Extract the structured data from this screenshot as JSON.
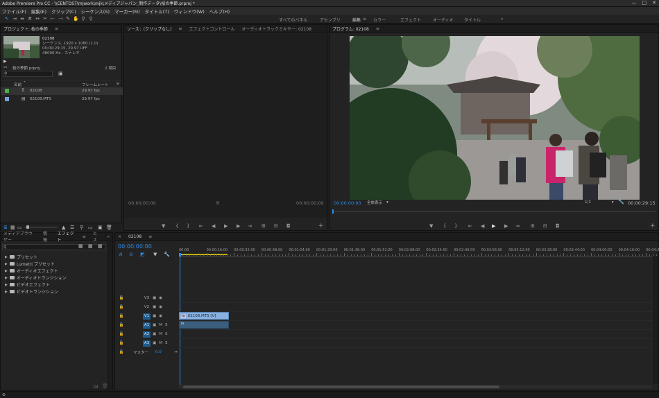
{
  "window": {
    "title": "Adobe Premiere Pro CC - \\\\CENTOS7\\mjwork\\mjk\\メディアジャパン_制作データ\\桜の季節.prproj *",
    "min": "—",
    "max": "□",
    "close": "✕"
  },
  "menu": [
    "ファイル(F)",
    "編集(E)",
    "クリップ(C)",
    "シーケンス(S)",
    "マーカー(M)",
    "タイトル(T)",
    "ウィンドウ(W)",
    "ヘルプ(H)"
  ],
  "workspaces": [
    "すべてのパネル",
    "アセンブリ",
    "編集",
    "カラー",
    "エフェクト",
    "オーディオ",
    "タイトル"
  ],
  "workspace_more": "»",
  "project": {
    "title": "プロジェクト: 桜の季節",
    "menu_glyph": "≡",
    "clip_name": "02108",
    "clip_info1": "シーケンス, 1920 x 1080 (1.0)",
    "clip_info2": "00;00;29;15, 29.97 UFF",
    "clip_info3": "48000 Hz - ステレオ",
    "file_name": "桜の季節.prproj",
    "item_count": "2 項目",
    "col_name": "名前",
    "col_rate": "フレームレート",
    "items": [
      {
        "name": "02108",
        "rate": "29.97 fps",
        "color": "#4caf50"
      },
      {
        "name": "02108.MTS",
        "rate": "29.97 fps",
        "color": "#7aa0d8"
      }
    ]
  },
  "source": {
    "tabs": [
      "ソース：(クリップなし)",
      "エフェクトコントロール",
      "オーディオトラックミキサー: 02108"
    ],
    "timecode_left": "00;00;00;00",
    "timecode_right": "00;00;00;00"
  },
  "program": {
    "title": "プログラム: 02108",
    "menu_glyph": "≡",
    "timecode": "00:00:00:00",
    "fit": "全体表示",
    "resolution": "1/2",
    "duration": "00:00:29:15"
  },
  "effects": {
    "tabs": [
      "メディアブラウザー",
      "情報",
      "エフェクト",
      "ヒス"
    ],
    "items": [
      "プリセット",
      "Lumetri プリセット",
      "オーディオエフェクト",
      "オーディオトランジション",
      "ビデオエフェクト",
      "ビデオトランジション"
    ]
  },
  "timeline": {
    "seq_tab": "02108",
    "timecode": "00:00:00:00",
    "ruler": [
      "00:00",
      "00:00:16:00",
      "00:00:32:00",
      "00:00:48:00",
      "00:01:04:00",
      "00:01:20:00",
      "00:01:36:00",
      "00:01:52:00",
      "00:02:08:00",
      "00:02:24:00",
      "00:02:40:00",
      "00:02:56:00",
      "00:03:12:00",
      "00:03:28:00",
      "00:03:44:00",
      "00:04:00:00",
      "00:04:16:00",
      "00:04:32:0"
    ],
    "tracks": [
      {
        "id": "V3",
        "kind": "video",
        "sel": false
      },
      {
        "id": "V2",
        "kind": "video",
        "sel": false
      },
      {
        "id": "V1",
        "kind": "video",
        "sel": true
      },
      {
        "id": "A1",
        "kind": "audio",
        "sel": true
      },
      {
        "id": "A2",
        "kind": "audio",
        "sel": true
      },
      {
        "id": "A3",
        "kind": "audio",
        "sel": true
      }
    ],
    "master_label": "マスター",
    "master_value": "0.0",
    "video_clip": "02108.MTS [V]",
    "fx_badge": "fx"
  }
}
